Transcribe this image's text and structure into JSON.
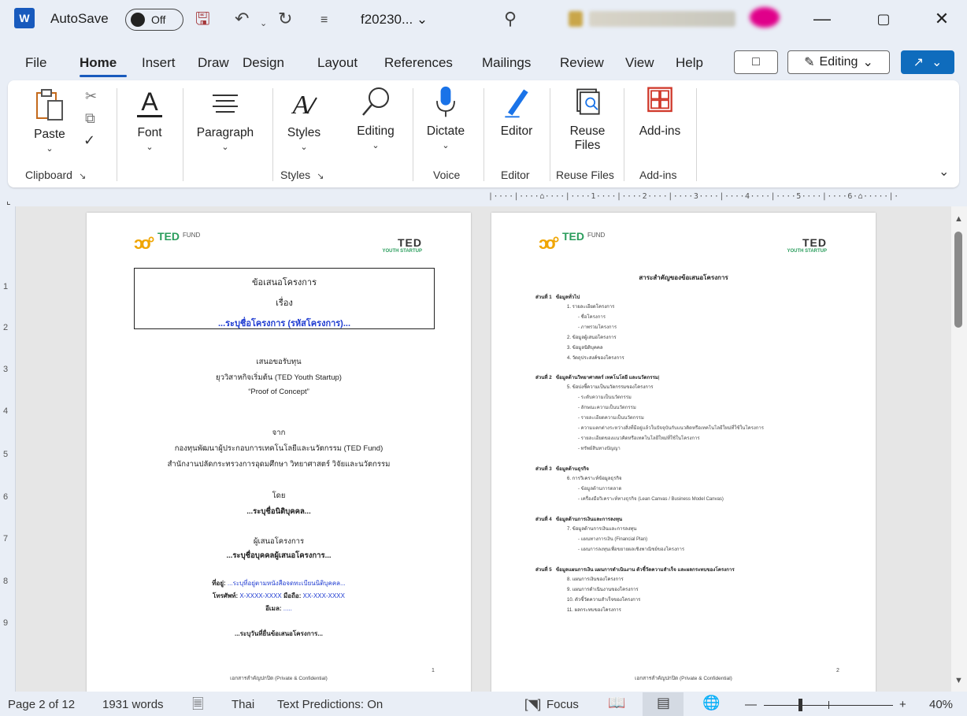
{
  "titlebar": {
    "app_letter": "W",
    "autosave_label": "AutoSave",
    "autosave_state": "Off",
    "filename": "f20230...",
    "filename_chevron": "⌄",
    "minimize": "—",
    "maximize": "▢",
    "close": "✕"
  },
  "menu": {
    "tabs": [
      "File",
      "Home",
      "Insert",
      "Draw",
      "Design",
      "Layout",
      "References",
      "Mailings",
      "Review",
      "View",
      "Help"
    ],
    "active": "Home",
    "comment_icon": "comment-icon",
    "editing_label": "Editing",
    "editing_chevron": "⌄",
    "share_chevron": "⌄"
  },
  "ribbon": {
    "clipboard": {
      "paste": "Paste",
      "group_label": "Clipboard"
    },
    "font": {
      "label": "Font"
    },
    "paragraph": {
      "label": "Paragraph"
    },
    "styles": {
      "label": "Styles",
      "group_label": "Styles"
    },
    "editing": {
      "label": "Editing"
    },
    "voice": {
      "dictate": "Dictate",
      "group_label": "Voice"
    },
    "editor": {
      "label": "Editor",
      "group_label": "Editor"
    },
    "reuse": {
      "label_line1": "Reuse",
      "label_line2": "Files",
      "group_label": "Reuse Files"
    },
    "addins": {
      "label": "Add-ins",
      "group_label": "Add-ins"
    }
  },
  "ruler": {
    "horizontal": "|····|····⌂····|····1····|····2····|····3····|····4····|····5····|····6·⌂·····|···",
    "vertical_numbers": [
      "1",
      "2",
      "3",
      "4",
      "5",
      "6",
      "7",
      "8",
      "9"
    ]
  },
  "page1": {
    "logo_left_ted": "TED",
    "logo_left_fund": "FUND",
    "logo_right_line1": "TED",
    "logo_right_line2": "YOUTH STARTUP",
    "box_line1": "ข้อเสนอโครงการ",
    "box_line2": "เรื่อง",
    "box_line3": "...ระบุชื่อโครงการ (รหัสโครงการ)...",
    "offer_line1": "เสนอขอรับทุน",
    "offer_line2": "ยุววิสาหกิจเริ่มต้น (TED Youth Startup)",
    "offer_line3": "“Proof of Concept”",
    "from_label": "จาก",
    "from_line1": "กองทุนพัฒนาผู้ประกอบการเทคโนโลยีและนวัตกรรม (TED Fund)",
    "from_line2": "สำนักงานปลัดกระทรวงการอุดมศึกษา วิทยาศาสตร์ วิจัยและนวัตกรรม",
    "by_label": "โดย",
    "by_value": "...ระบุชื่อนิติบุคคล...",
    "proposer_label": "ผู้เสนอโครงการ",
    "proposer_value": "...ระบุชื่อบุคคลผู้เสนอโครงการ...",
    "address_label": "ที่อยู่:",
    "address_value": "...ระบุที่อยู่ตามหนังสือจดทะเบียนนิติบุคคล...",
    "phone_label": "โทรศัพท์:",
    "phone_value": "X-XXXX-XXXX",
    "mobile_label": "มือถือ:",
    "mobile_value": "XX-XXX-XXXX",
    "email_label": "อีเมล:",
    "email_value": ".....",
    "date_line": "...ระบุวันที่ยื่นข้อเสนอโครงการ...",
    "footer": "เอกสารสำคัญปกปิด (Private & Confidential)",
    "page_number": "1"
  },
  "page2": {
    "title": "สาระสำคัญของข้อเสนอโครงการ",
    "sections": [
      {
        "head": "ส่วนที่ 1",
        "title": "ข้อมูลทั่วไป"
      },
      {
        "head": "ส่วนที่ 2",
        "title": "ข้อมูลด้านวิทยาศาสตร์ เทคโนโลยี และนวัตกรรม"
      },
      {
        "head": "ส่วนที่ 3",
        "title": "ข้อมูลด้านธุรกิจ"
      },
      {
        "head": "ส่วนที่ 4",
        "title": "ข้อมูลด้านการเงินและการลงทุน"
      },
      {
        "head": "ส่วนที่ 5",
        "title": "ข้อมูลแผนการเงิน แผนการดำเนินงาน ตัวชี้วัดความสำเร็จ และผลกระทบของโครงการ"
      }
    ],
    "s1": [
      "1. รายละเอียดโครงการ",
      "- ชื่อโครงการ",
      "- ภาพรวมโครงการ",
      "2. ข้อมูลผู้เสนอโครงการ",
      "3. ข้อมูลนิติบุคคล",
      "4. วัตถุประสงค์ของโครงการ"
    ],
    "s2": [
      "5. ข้อบ่งชี้ความเป็นนวัตกรรมของโครงการ",
      "- ระดับความเป็นนวัตกรรม",
      "- ลักษณะความเป็นนวัตกรรม",
      "- รายละเอียดความเป็นนวัตกรรม",
      "- ความแตกต่างระหว่างสิ่งที่มีอยู่แล้วในปัจจุบันกับแนวคิดหรือเทคโนโลยีใหม่ที่ใช้ในโครงการ",
      "- รายละเอียดของแนวคิดหรือเทคโนโลยีใหม่ที่ใช้ในโครงการ",
      "- ทรัพย์สินทางปัญญา"
    ],
    "s3": [
      "6. การวิเคราะห์ข้อมูลธุรกิจ",
      "- ข้อมูลด้านการตลาด",
      "- เครื่องมือวิเคราะห์ทางธุรกิจ (Lean Canvas / Business Model Canvas)"
    ],
    "s4": [
      "7. ข้อมูลด้านการเงินและการลงทุน",
      "- แผนทางการเงิน (Financial Plan)",
      "- แผนการลงทุนเพื่อขยายผลเชิงพาณิชย์ของโครงการ"
    ],
    "s5": [
      "8. แผนการเงินของโครงการ",
      "9. แผนการดำเนินงานของโครงการ",
      "10. ตัวชี้วัดความสำเร็จของโครงการ",
      "11. ผลกระทบของโครงการ"
    ],
    "footer": "เอกสารสำคัญปกปิด (Private & Confidential)",
    "page_number": "2"
  },
  "statusbar": {
    "page": "Page 2 of 12",
    "words": "1931 words",
    "language": "Thai",
    "predictions": "Text Predictions: On",
    "focus": "Focus",
    "zoom_minus": "—",
    "zoom_plus": "+",
    "zoom": "40%"
  }
}
